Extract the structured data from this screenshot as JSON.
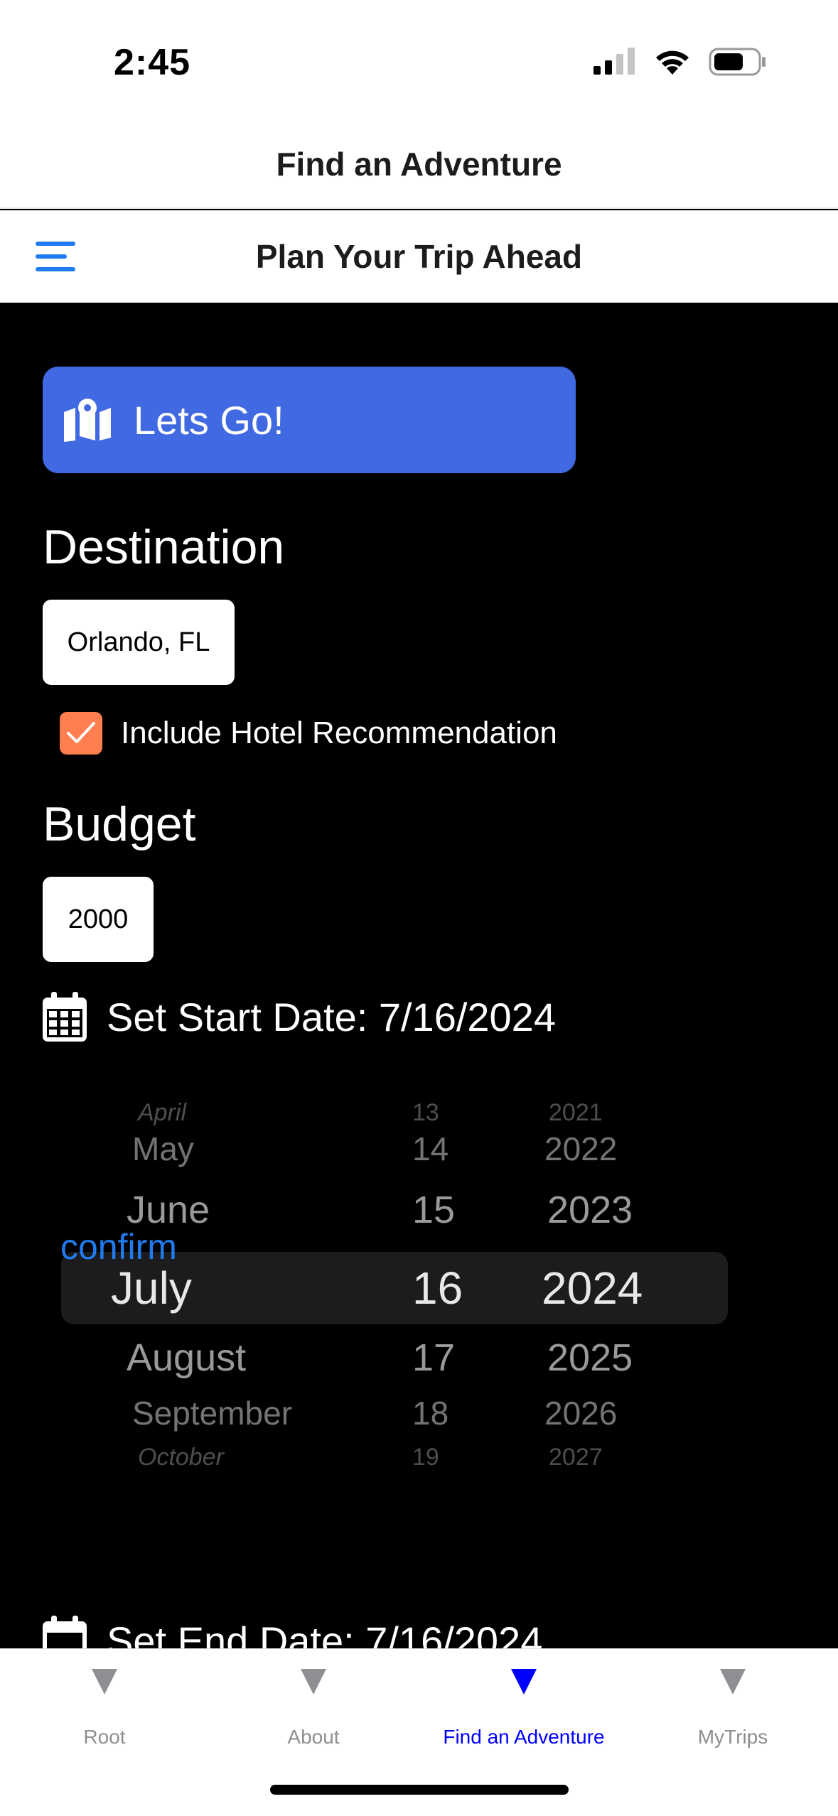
{
  "status_bar": {
    "time": "2:45"
  },
  "nav": {
    "title": "Find an Adventure"
  },
  "header": {
    "title": "Plan Your Trip Ahead",
    "menu_icon": "hamburger-menu-icon"
  },
  "go_button": {
    "label": "Lets Go!",
    "icon": "map-icon",
    "color": "#4169e1"
  },
  "destination": {
    "title": "Destination",
    "value": "Orlando, FL"
  },
  "hotel_option": {
    "label": "Include Hotel Recommendation",
    "checked": true,
    "color": "#ff7f50"
  },
  "budget": {
    "title": "Budget",
    "value": "2000"
  },
  "start_date": {
    "label": "Set Start Date: 7/16/2024",
    "icon": "calendar-icon"
  },
  "picker": {
    "months": [
      "April",
      "May",
      "June",
      "July",
      "August",
      "September",
      "October"
    ],
    "days": [
      "13",
      "14",
      "15",
      "16",
      "17",
      "18",
      "19"
    ],
    "years": [
      "2021",
      "2022",
      "2023",
      "2024",
      "2025",
      "2026",
      "2027"
    ],
    "selected": {
      "month": "July",
      "day": "16",
      "year": "2024"
    }
  },
  "confirm": {
    "label": "confirm"
  },
  "end_date": {
    "label": "Set End Date: 7/16/2024",
    "icon": "calendar-icon"
  },
  "tabs": [
    {
      "label": "Root",
      "active": false
    },
    {
      "label": "About",
      "active": false
    },
    {
      "label": "Find an Adventure",
      "active": true
    },
    {
      "label": "MyTrips",
      "active": false
    }
  ],
  "colors": {
    "accent": "#1f7bf0",
    "active_tab": "#0000ff",
    "inactive_tab": "#8e8e93"
  }
}
